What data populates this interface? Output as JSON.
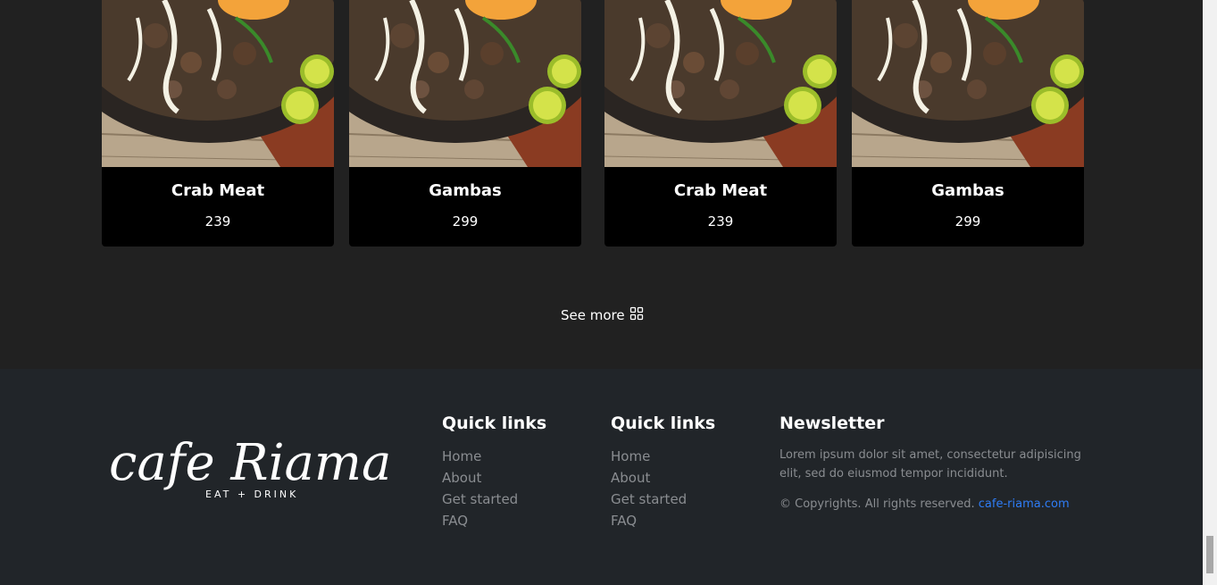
{
  "menu": {
    "cards": [
      {
        "name": "Crab Meat",
        "price": "239"
      },
      {
        "name": "Gambas",
        "price": "299"
      },
      {
        "name": "Crab Meat",
        "price": "239"
      },
      {
        "name": "Gambas",
        "price": "299"
      }
    ],
    "see_more_label": "See more",
    "see_more_icon": "grid-icon"
  },
  "footer": {
    "logo_text": "cafe Riama",
    "logo_tagline": "EAT + DRINK",
    "quick_links_1": {
      "title": "Quick links",
      "items": [
        "Home",
        "About",
        "Get started",
        "FAQ"
      ]
    },
    "quick_links_2": {
      "title": "Quick links",
      "items": [
        "Home",
        "About",
        "Get started",
        "FAQ"
      ]
    },
    "newsletter": {
      "title": "Newsletter",
      "text": "Lorem ipsum dolor sit amet, consectetur adipisicing elit, sed do eiusmod tempor incididunt.",
      "copyright": "© Copyrights. All rights reserved.",
      "link_text": "cafe-riama.com"
    }
  },
  "colors": {
    "background": "#212121",
    "footer_bg": "#212529",
    "card_bg": "#000000",
    "link_blue": "#2f7df6",
    "muted_text": "#8a8d91"
  }
}
